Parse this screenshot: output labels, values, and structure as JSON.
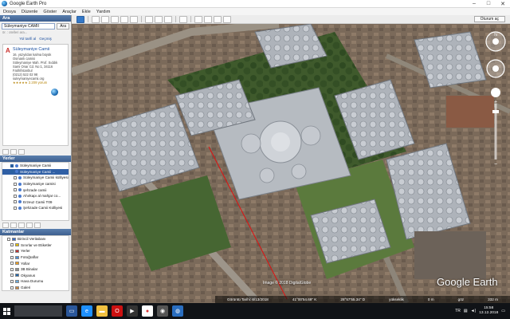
{
  "window": {
    "title": "Google Earth Pro"
  },
  "menu": [
    "Dosya",
    "Düzenle",
    "Göster",
    "Araçlar",
    "Ekle",
    "Yardım"
  ],
  "toolbar": {
    "signin_label": "Oturum aç"
  },
  "search": {
    "header": "Ara",
    "value": "Süleymaniye CAMII",
    "button": "Ara",
    "hint": "ör. : otelleri ara...",
    "links": [
      "Yol tarifi al",
      "Geçmiş"
    ]
  },
  "result": {
    "marker": "A",
    "name": "Süleymaniye Camii",
    "lines": [
      "16. yüzyıldan kalma büyük",
      "Osmanlı camisi",
      "Süleymaniye Mah. Prof. Sıddık",
      "Sami Onar Cd. No:1, 34116",
      "Fatih/İstanbul",
      "(0212) 522 02 98",
      "suleymaniyecamii.org"
    ],
    "rating": "★★★★★ 2.209 yorum"
  },
  "places": {
    "header": "Yerler",
    "items": [
      {
        "label": "Süleymaniye Camii",
        "level": 2,
        "checked": true,
        "selected": false
      },
      {
        "label": "Süleymaniye Camii ...",
        "level": 2,
        "checked": true,
        "selected": true
      },
      {
        "label": "Süleymaniye Camii külliyesi",
        "level": 3,
        "checked": false,
        "selected": false
      },
      {
        "label": "Süleymaniye camisi",
        "level": 3,
        "checked": false,
        "selected": false
      },
      {
        "label": "şehzade camii",
        "level": 3,
        "checked": false,
        "selected": false
      },
      {
        "label": "Ahırkapı al mahjar co...",
        "level": 3,
        "checked": false,
        "selected": false
      },
      {
        "label": "Erzeuz Camii T09",
        "level": 3,
        "checked": false,
        "selected": false
      },
      {
        "label": "Şehzade Camii Külliyesi",
        "level": 3,
        "checked": false,
        "selected": false
      }
    ]
  },
  "layers": {
    "header": "Katmanlar",
    "items": [
      {
        "label": "Birincil Veritabanı",
        "level": 1,
        "color": "#3b6cc4"
      },
      {
        "label": "Sınırlar ve Etiketler",
        "level": 2,
        "color": "#e6c000"
      },
      {
        "label": "Yerler",
        "level": 2,
        "color": "#c03030"
      },
      {
        "label": "Fotoğraflar",
        "level": 2,
        "color": "#4b8fd8"
      },
      {
        "label": "Yollar",
        "level": 2,
        "color": "#f0a020"
      },
      {
        "label": "3B Binalar",
        "level": 2,
        "color": "#909090"
      },
      {
        "label": "Okyanus",
        "level": 2,
        "color": "#2266aa"
      },
      {
        "label": "Hava Durumu",
        "level": 2,
        "color": "#66aadd"
      },
      {
        "label": "Galeri",
        "level": 2,
        "color": "#cc8844"
      }
    ]
  },
  "map": {
    "image_credit": "Image © 2018 DigitalGlobe",
    "logo": "Google Earth",
    "scale_label": "60 m",
    "status": {
      "date": "Görüntü Tarihi: 6/13/2018",
      "lat": "41°00'54.69\" K",
      "lon": "28°57'55.34\" D",
      "elev_label": "yükseklik",
      "elev": "0 m",
      "eye_label": "göz",
      "eye_value": "göz rakımı",
      "eye_alt": "332 m"
    }
  },
  "taskbar": {
    "mini_label": "2041",
    "tray_lang": "TR",
    "time": "15:58",
    "date": "13.12.2018"
  }
}
